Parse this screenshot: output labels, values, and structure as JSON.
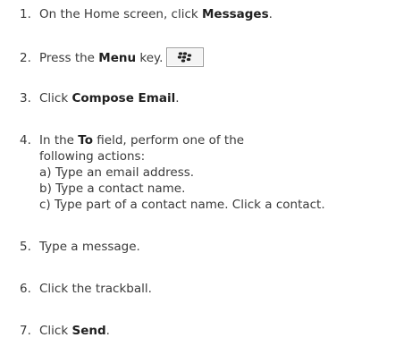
{
  "steps": [
    {
      "num": "1.",
      "pre": "On the Home screen, click ",
      "bold": "Messages",
      "post": "."
    },
    {
      "num": "2.",
      "pre": "Press the ",
      "bold": "Menu",
      "post": " key.",
      "icon": "blackberry-menu-key-icon"
    },
    {
      "num": "3.",
      "pre": "Click ",
      "bold": "Compose Email",
      "post": "."
    },
    {
      "num": "4.",
      "pre": "In the ",
      "bold": "To",
      "post": " field, perform one of the",
      "lines": [
        "following actions:",
        "a) Type an email address.",
        "b) Type a contact name.",
        "c) Type part of a contact name. Click a contact."
      ]
    },
    {
      "num": "5.",
      "text": "Type a message."
    },
    {
      "num": "6.",
      "text": "Click the trackball."
    },
    {
      "num": "7.",
      "pre": "Click ",
      "bold": "Send",
      "post": "."
    }
  ]
}
